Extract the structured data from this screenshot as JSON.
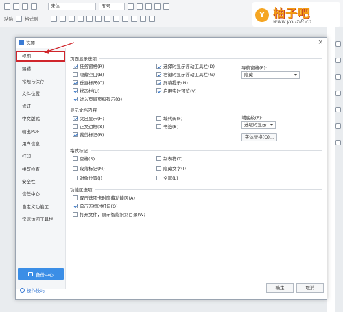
{
  "ribbon": {
    "font_name": "宋体",
    "font_size": "五号",
    "format_painter": "格式刷",
    "paste": "粘贴"
  },
  "brand": {
    "logo_char": "Y",
    "name": "柚子吧",
    "url": "www.youzi8.cn",
    "color": "#f39c12"
  },
  "dialog": {
    "title": "选项",
    "nav": [
      {
        "label": "视图",
        "active": true
      },
      {
        "label": "编辑"
      },
      {
        "label": "常规与保存"
      },
      {
        "label": "文件位置"
      },
      {
        "label": "修订"
      },
      {
        "label": "中文版式"
      },
      {
        "label": "输出PDF"
      },
      {
        "label": "用户信息"
      },
      {
        "label": "打印"
      },
      {
        "label": "拼写检查"
      },
      {
        "label": "安全性"
      },
      {
        "label": "信任中心"
      },
      {
        "label": "自定义功能区"
      },
      {
        "label": "快速访问工具栏"
      }
    ],
    "backup_label": "备份中心",
    "tips_label": "操作技巧",
    "ok_label": "确定",
    "cancel_label": "取消",
    "page_display": {
      "title": "页面显示选项",
      "col1": [
        {
          "label": "任务窗格(R)",
          "checked": true
        },
        {
          "label": "隐藏空白(B)",
          "checked": false
        },
        {
          "label": "垂直标尺(C)",
          "checked": true
        },
        {
          "label": "状态栏(U)",
          "checked": true
        },
        {
          "label": "进入页眉页脚提示(Q)",
          "checked": true
        }
      ],
      "col2": [
        {
          "label": "选择时显示浮动工具栏(D)",
          "checked": true
        },
        {
          "label": "右键时显示浮动工具栏(G)",
          "checked": true
        },
        {
          "label": "屏幕提示(N)",
          "checked": true
        },
        {
          "label": "启用实时预览(V)",
          "checked": true
        }
      ],
      "nav_pane_label": "导航窗格(P):",
      "nav_pane_value": "隐藏"
    },
    "show_content": {
      "title": "显示文档内容",
      "col1": [
        {
          "label": "突出显示(H)",
          "checked": true
        },
        {
          "label": "正文边框(X)",
          "checked": false
        },
        {
          "label": "裁剪标记(R)",
          "checked": true
        }
      ],
      "col2": [
        {
          "label": "域代码(F)",
          "checked": false
        },
        {
          "label": "书签(K)",
          "checked": false
        }
      ],
      "field_shading_label": "域底纹(E):",
      "field_shading_value": "选取时显示",
      "font_replace_label": "字体替换(O)..."
    },
    "format_marks": {
      "title": "格式标记",
      "col1": [
        {
          "label": "空格(S)",
          "checked": false
        },
        {
          "label": "段落标记(M)",
          "checked": false
        },
        {
          "label": "对象位置(J)",
          "checked": false
        }
      ],
      "col2": [
        {
          "label": "制表符(T)",
          "checked": false
        },
        {
          "label": "隐藏文字(I)",
          "checked": false
        },
        {
          "label": "全部(L)",
          "checked": false
        }
      ]
    },
    "ribbon_options": {
      "title": "功能区选项",
      "items": [
        {
          "label": "双击选项卡时隐藏功能区(A)",
          "checked": false
        },
        {
          "label": "单击方框时打勾(O)",
          "checked": true
        },
        {
          "label": "打开文件，展示智能识别目录(W)",
          "checked": false
        }
      ]
    }
  },
  "colors": {
    "accent": "#3b8ee6",
    "highlight": "#d0262c"
  }
}
